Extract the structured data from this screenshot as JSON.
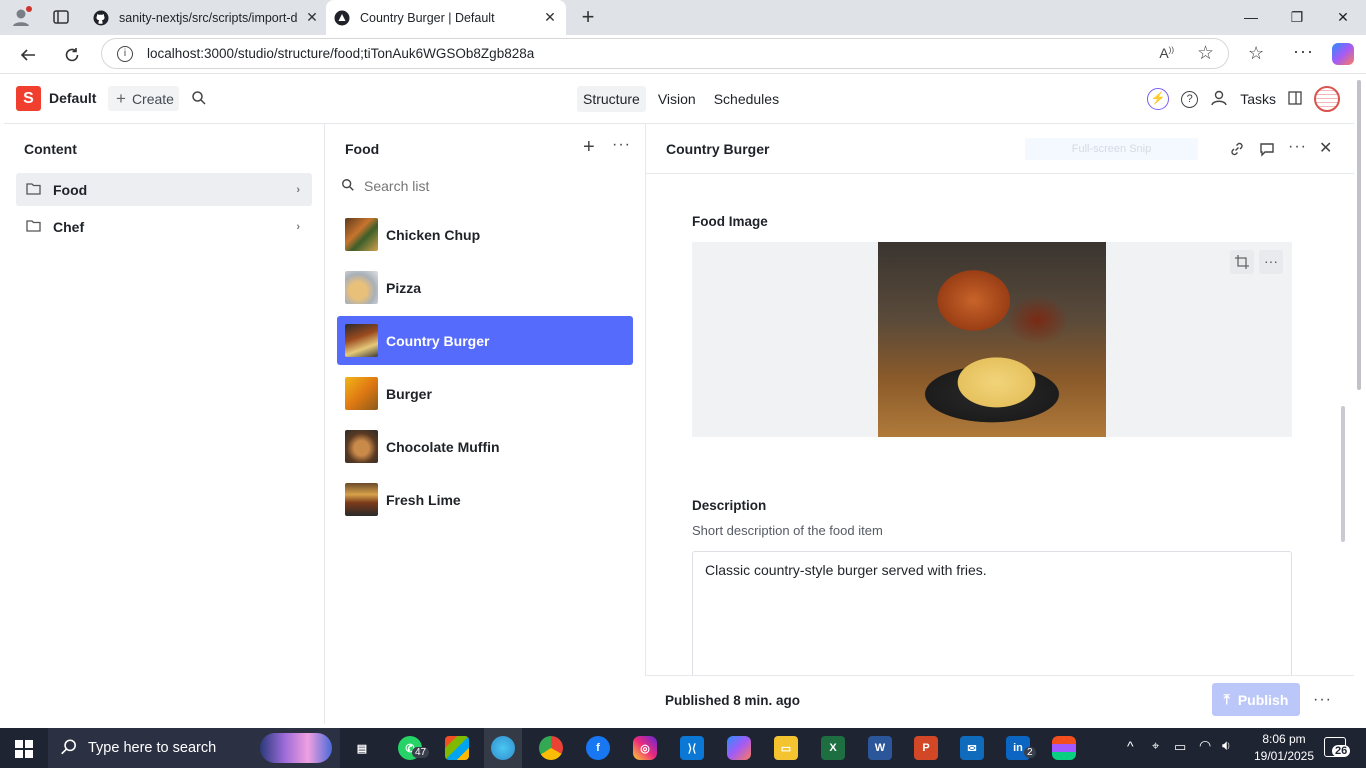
{
  "browser": {
    "tabs": [
      {
        "title": "sanity-nextjs/src/scripts/import-d"
      },
      {
        "title": "Country Burger | Default"
      }
    ],
    "url": "localhost:3000/studio/structure/food;tiTonAuk6WGSOb8Zgb828a"
  },
  "studio": {
    "workspace": "Default",
    "create_label": "Create",
    "tools": [
      "Structure",
      "Vision",
      "Schedules"
    ],
    "tasks_label": "Tasks"
  },
  "content_pane": {
    "title": "Content",
    "items": [
      {
        "label": "Food"
      },
      {
        "label": "Chef"
      }
    ]
  },
  "food_pane": {
    "title": "Food",
    "search_placeholder": "Search list",
    "documents": [
      {
        "title": "Chicken Chup"
      },
      {
        "title": "Pizza"
      },
      {
        "title": "Country Burger"
      },
      {
        "title": "Burger"
      },
      {
        "title": "Chocolate Muffin"
      },
      {
        "title": "Fresh Lime"
      }
    ]
  },
  "editor": {
    "title": "Country Burger",
    "snip_label": "Full-screen Snip",
    "image_label": "Food Image",
    "description_label": "Description",
    "description_help": "Short description of the food item",
    "description_value": "Classic country-style burger served with fries.",
    "status": "Published 8 min. ago",
    "publish_label": "Publish"
  },
  "taskbar": {
    "search_placeholder": "Type here to search",
    "whatsapp_badge": "47",
    "linkedin_badge": "2",
    "time": "8:06 pm",
    "date": "19/01/2025",
    "notifications": "26"
  },
  "colors": {
    "accent": "#556bfc",
    "brand": "#f03e2f",
    "taskbar": "#1f2433"
  }
}
